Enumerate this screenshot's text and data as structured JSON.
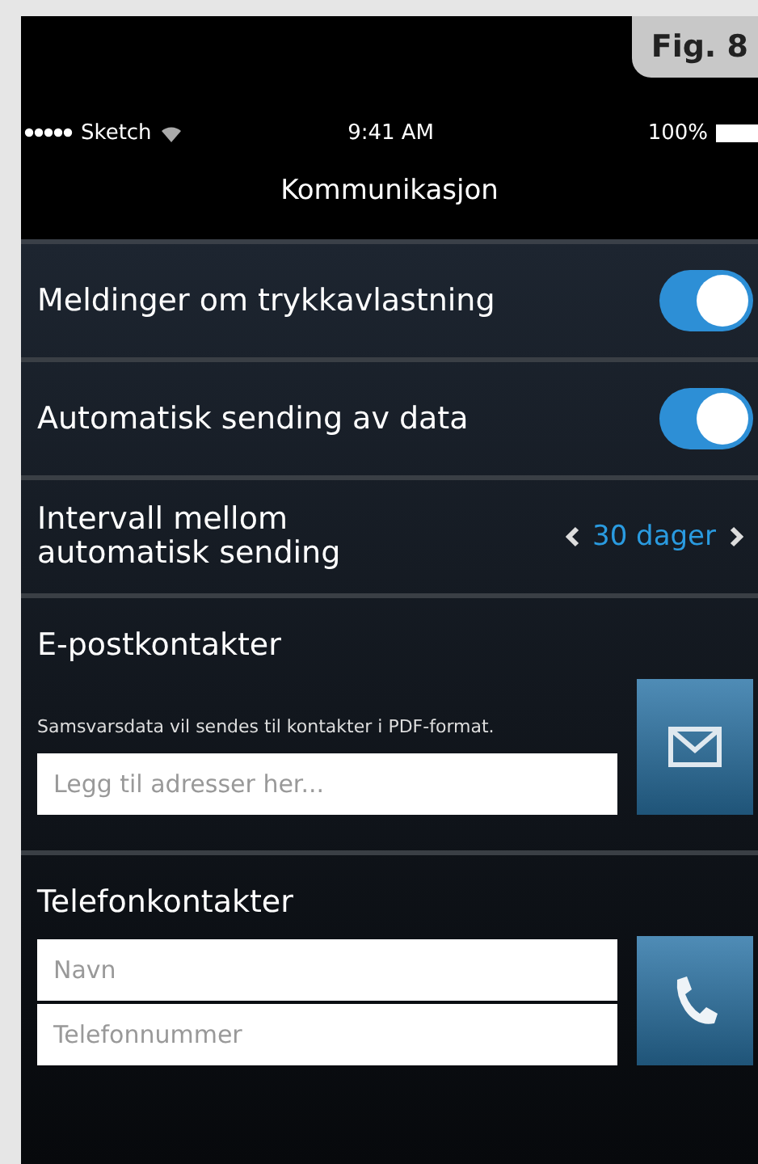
{
  "figure_label": "Fig. 8",
  "status_bar": {
    "carrier": "Sketch",
    "time": "9:41 AM",
    "battery": "100%"
  },
  "title": "Kommunikasjon",
  "settings": [
    {
      "kind": "toggle",
      "label": "Meldinger om trykkavlastning",
      "on": true
    },
    {
      "kind": "toggle",
      "label": "Automatisk sending av data",
      "on": true
    },
    {
      "kind": "stepper",
      "label": "Intervall mellom automatisk sending",
      "value": "30 dager"
    }
  ],
  "email": {
    "heading": "E-postkontakter",
    "note": "Samsvarsdata vil sendes til kontakter i PDF-format.",
    "placeholder": "Legg til adresser her..."
  },
  "phone": {
    "heading": "Telefonkontakter",
    "name_placeholder": "Navn",
    "number_placeholder": "Telefonnummer"
  }
}
